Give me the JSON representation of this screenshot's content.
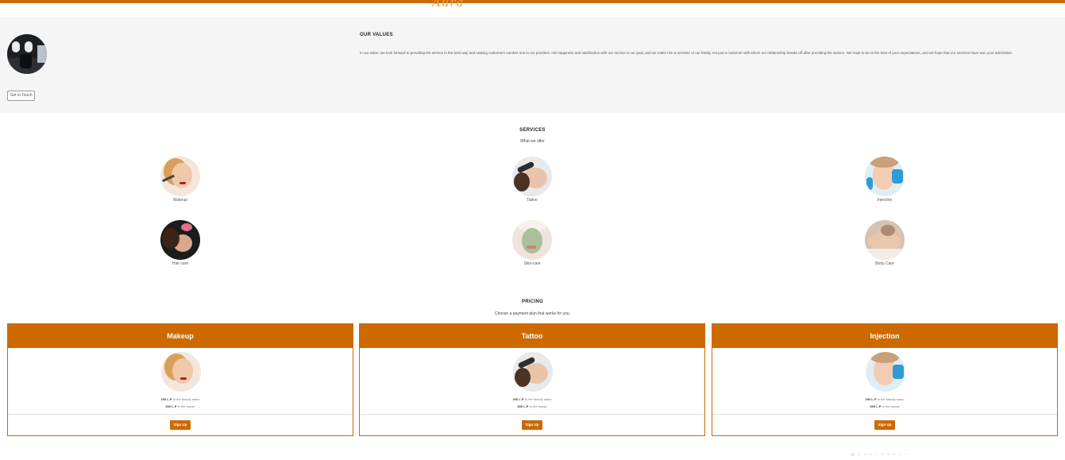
{
  "header": {
    "logo_text": "Aura"
  },
  "values": {
    "title": "OUR VALUES",
    "text": "In our salon, we look forward to providing the service in the best way and making customers number one in our priorities. His happiness and satisfaction with our service is our goal, and we make him a member of our family, not just a customer with whom our relationship breaks off after providing the service. We hope to be at the best of your expectations, and we hope that our services have won your admiration.",
    "contact_button": "Get in Touch"
  },
  "services": {
    "title": "SERVICES",
    "subtitle": "What we offer",
    "items": [
      {
        "label": "Makeup"
      },
      {
        "label": "Tattoo"
      },
      {
        "label": "Injection"
      },
      {
        "label": "Hair care"
      },
      {
        "label": "Skin-care"
      },
      {
        "label": "Body Care"
      }
    ]
  },
  "pricing": {
    "title": "PRICING",
    "subtitle": "Choose a payment plan that works for you.",
    "plans": [
      {
        "name": "Makeup",
        "price_salon": "200 L.P",
        "salon_note": "In the beauty salon",
        "price_home": "300 L.P",
        "home_note": "In the house",
        "button": "Sign Up"
      },
      {
        "name": "Tattoo",
        "price_salon": "200 L.P",
        "salon_note": "In the beauty salon",
        "price_home": "300 L.P",
        "home_note": "In the house",
        "button": "Sign Up"
      },
      {
        "name": "Injection",
        "price_salon": "200 L.P",
        "salon_note": "In the beauty salon",
        "price_home": "300 L.P",
        "home_note": "In the house",
        "button": "Sign Up"
      }
    ]
  },
  "colors": {
    "accent": "#cc6a00",
    "section_bg": "#f5f5f5"
  }
}
